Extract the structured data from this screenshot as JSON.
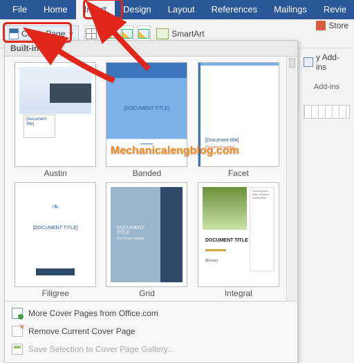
{
  "tabs": {
    "file": "File",
    "home": "Home",
    "insert": "Insert",
    "design": "Design",
    "layout": "Layout",
    "references": "References",
    "mailings": "Mailings",
    "review": "Revie"
  },
  "ribbon": {
    "cover_page_label": "Cover Page",
    "smartart_label": "SmartArt",
    "store_label": "Store",
    "my_addins_label": "y Add-ins",
    "addins_label": "Add-ins"
  },
  "dropdown": {
    "section_header": "Built-in",
    "templates": [
      {
        "name": "Austin",
        "doc_title": "[Document title]"
      },
      {
        "name": "Banded",
        "doc_title": "[DOCUMENT TITLE]"
      },
      {
        "name": "Facet",
        "doc_title": "[Document title]",
        "subtitle": "[Document subtitle]"
      },
      {
        "name": "Filigree",
        "doc_title": "[DOCUMENT TITLE]"
      },
      {
        "name": "Grid",
        "doc_title": "DOCUMENT TITLE",
        "subtitle": "Document subtitle"
      },
      {
        "name": "Integral",
        "doc_title": "DOCUMENT TITLE",
        "subtitle": "Abstract"
      }
    ],
    "footer": {
      "more": "More Cover Pages from Office.com",
      "remove": "Remove Current Cover Page",
      "save": "Save Selection to Cover Page Gallery..."
    }
  },
  "watermark": "Mechanicalengblog.com"
}
